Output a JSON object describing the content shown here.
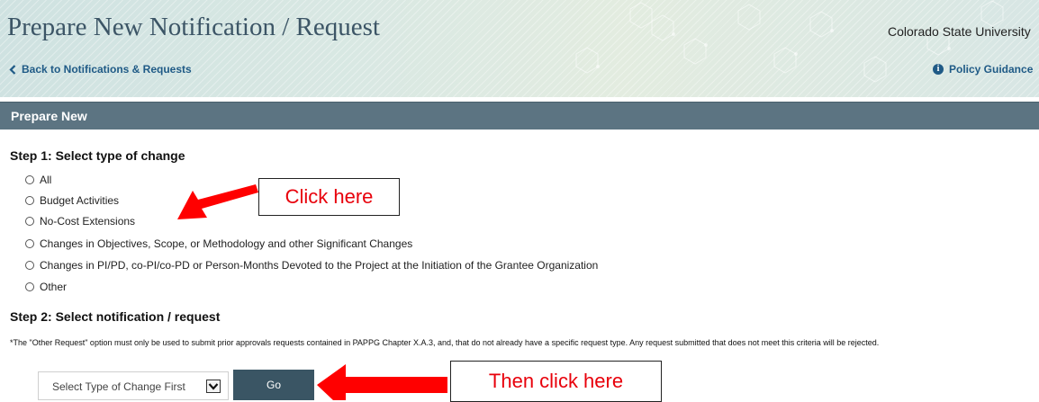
{
  "header": {
    "title": "Prepare New Notification / Request",
    "organization": "Colorado State University",
    "back_link": "Back to Notifications & Requests",
    "policy_link": "Policy Guidance"
  },
  "section": {
    "title": "Prepare New"
  },
  "step1": {
    "heading": "Step 1: Select type of change",
    "options": [
      "All",
      "Budget Activities",
      "No-Cost Extensions",
      "Changes in Objectives, Scope, or Methodology and other Significant Changes",
      "Changes in PI/PD, co-PI/co-PD or Person-Months Devoted to the Project at the Initiation of the Grantee Organization",
      "Other"
    ]
  },
  "step2": {
    "heading": "Step 2: Select notification / request",
    "note": "*The \"Other Request\" option must only be used to submit prior approvals requests contained in PAPPG Chapter X.A.3, and, that do not already have a specific request type. Any request submitted that does not meet this criteria will be rejected.",
    "select_value": "Select Type of Change First",
    "go_label": "Go"
  },
  "annotations": {
    "callout1": "Click here",
    "callout2": "Then click here",
    "arrow_color": "#ff0000"
  },
  "icons": {
    "back": "chevron-left-icon",
    "policy": "info-icon",
    "select": "chevron-down-icon"
  }
}
